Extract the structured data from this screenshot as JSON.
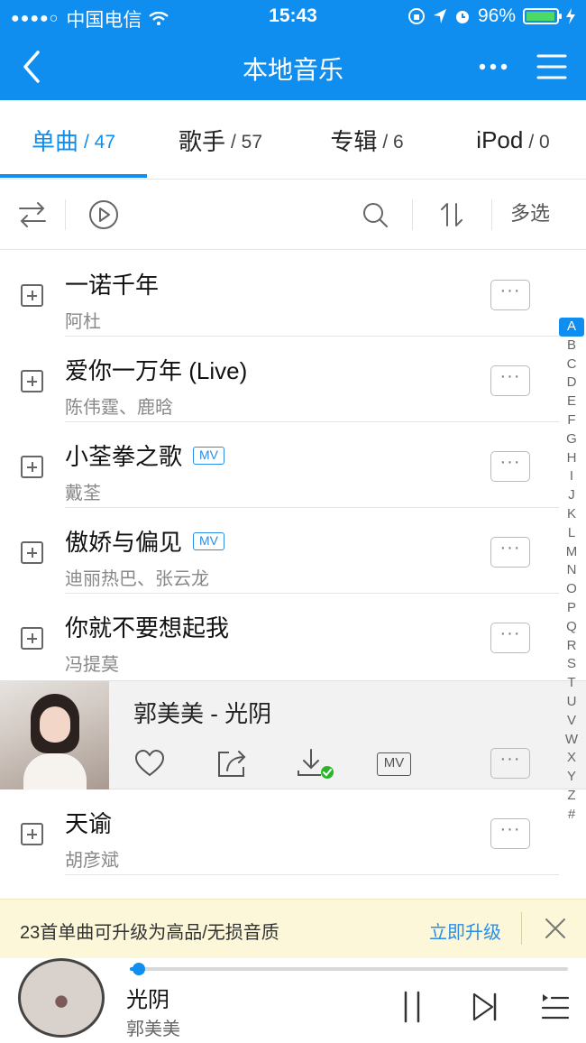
{
  "status": {
    "carrier": "中国电信",
    "time": "15:43",
    "battery": "96%",
    "battery_level": 0.96
  },
  "nav": {
    "title": "本地音乐"
  },
  "tabs": [
    {
      "label": "单曲",
      "count": "/ 47"
    },
    {
      "label": "歌手",
      "count": "/ 57"
    },
    {
      "label": "专辑",
      "count": "/ 6"
    },
    {
      "label": "iPod",
      "count": "/ 0"
    }
  ],
  "toolbar": {
    "multi_select": "多选"
  },
  "songs": [
    {
      "title": "一诺千年",
      "artist": "阿杜",
      "mv": false
    },
    {
      "title": "爱你一万年 (Live)",
      "artist": "陈伟霆、鹿晗",
      "mv": false
    },
    {
      "title": "小荃拳之歌",
      "artist": "戴荃",
      "mv": true
    },
    {
      "title": "傲娇与偏见",
      "artist": "迪丽热巴、张云龙",
      "mv": true
    },
    {
      "title": "你就不要想起我",
      "artist": "冯提莫",
      "mv": false
    },
    {
      "title": "天谕",
      "artist": "胡彦斌",
      "mv": false
    }
  ],
  "mv_label": "MV",
  "now_playing_row": {
    "title": "郭美美 - 光阴",
    "mv_label": "MV"
  },
  "index_letters": [
    "A",
    "B",
    "C",
    "D",
    "E",
    "F",
    "G",
    "H",
    "I",
    "J",
    "K",
    "L",
    "M",
    "N",
    "O",
    "P",
    "Q",
    "R",
    "S",
    "T",
    "U",
    "V",
    "W",
    "X",
    "Y",
    "Z",
    "#"
  ],
  "banner": {
    "message": "23首单曲可升级为高品/无损音质",
    "action": "立即升级"
  },
  "player": {
    "title": "光阴",
    "artist": "郭美美",
    "progress": 0.02
  },
  "colors": {
    "accent": "#0f8ef0",
    "banner_bg": "#fbf7d8",
    "download_ok": "#2ab52a"
  },
  "icons": [
    "back-icon",
    "more-icon",
    "menu-icon",
    "shuffle-icon",
    "play-circle-icon",
    "search-icon",
    "sort-icon",
    "add-icon",
    "heart-icon",
    "share-icon",
    "download-icon",
    "close-icon",
    "pause-icon",
    "next-icon",
    "playlist-icon"
  ]
}
